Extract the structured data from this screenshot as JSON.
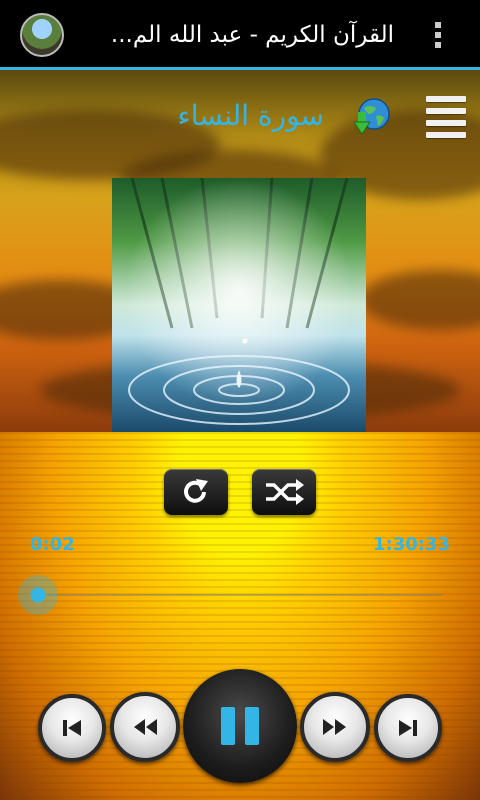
{
  "app": {
    "title": "القرآن الكريم - عبد الله الم...",
    "icon": "app-icon",
    "overflow_icon": "overflow-menu-icon"
  },
  "player": {
    "surah_title": "سورة النساء",
    "download_icon": "globe-download-icon",
    "menu_icon": "hamburger-menu-icon",
    "elapsed": "0:02",
    "total": "1:30:33",
    "progress": 0.0004,
    "state": "playing"
  },
  "controls": {
    "repeat_icon": "repeat-icon",
    "shuffle_icon": "shuffle-icon",
    "prev_icon": "skip-previous-icon",
    "rewind_icon": "rewind-icon",
    "pause_icon": "pause-icon",
    "forward_icon": "fast-forward-icon",
    "next_icon": "skip-next-icon"
  },
  "colors": {
    "accent": "#33b5e5",
    "action_bar": "#000000"
  }
}
